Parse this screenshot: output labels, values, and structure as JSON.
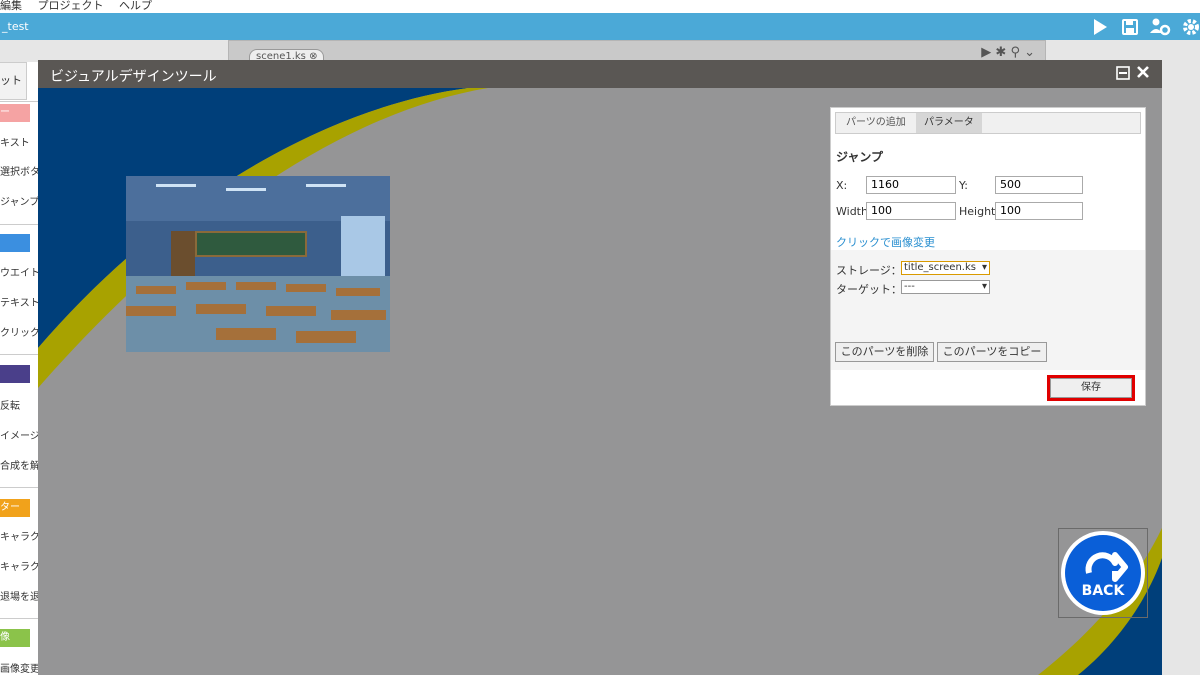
{
  "menu": [
    "編集",
    "プロジェクト",
    "ヘルプ"
  ],
  "project": {
    "title": "_test"
  },
  "toolbar": {
    "icons": [
      "play-icon",
      "save-icon",
      "users-gear-icon",
      "gear-icon"
    ]
  },
  "editor": {
    "tab_label": "scene1.ks"
  },
  "sidebar": {
    "tab_label": "ット",
    "sections": [
      {
        "color": "#f5a3a3",
        "header": "ー",
        "items": [
          "キスト",
          "選択ボタン",
          "ジャンプ"
        ]
      },
      {
        "color": "#3b8fe0",
        "header": "",
        "items": [
          "ウエイト",
          "テキスト配置",
          "クリック待ち"
        ]
      },
      {
        "color": "#4a3f8a",
        "header": "",
        "items": [
          "反転",
          "イメージ合成",
          "合成を解除"
        ]
      },
      {
        "color": "#f1a21b",
        "header": "ター",
        "items": [
          "キャラクター",
          "キャラクター",
          "退場を退場"
        ]
      },
      {
        "color": "#8bc34a",
        "header": "像",
        "items": [
          "画像変更"
        ]
      }
    ]
  },
  "modal": {
    "title": "ビジュアルデザインツール",
    "icons": [
      "window-icon",
      "close-icon"
    ]
  },
  "panel": {
    "tabs": [
      "パーツの追加",
      "パラメータ"
    ],
    "active_tab": "パラメータ",
    "heading": "ジャンプ",
    "x_label": "X:",
    "x_value": "1160",
    "y_label": "Y:",
    "y_value": "500",
    "width_label": "Width:",
    "width_value": "100",
    "height_label": "Height:",
    "height_value": "100",
    "image_link": "クリックで画像変更",
    "storage_label": "ストレージ：",
    "storage_value": "title_screen.ks",
    "target_label": "ターゲット：",
    "target_value": "---",
    "delete_button": "このパーツを削除",
    "copy_button": "このパーツをコピー",
    "save_button": "保存"
  },
  "back_button": {
    "label": "BACK"
  },
  "colors": {
    "accent": "#4ba9d7",
    "navy": "#003f7a",
    "olive": "#a8a200",
    "highlight": "#e00000"
  }
}
